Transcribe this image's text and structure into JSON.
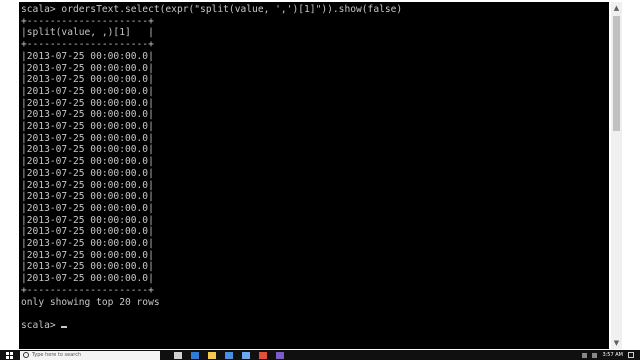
{
  "console": {
    "lines": [
      "scala> ordersText.select(expr(\"split(value, ',')[1]\")).show(false)",
      "+---------------------+",
      "|split(value, ,)[1]   |",
      "+---------------------+",
      "|2013-07-25 00:00:00.0|",
      "|2013-07-25 00:00:00.0|",
      "|2013-07-25 00:00:00.0|",
      "|2013-07-25 00:00:00.0|",
      "|2013-07-25 00:00:00.0|",
      "|2013-07-25 00:00:00.0|",
      "|2013-07-25 00:00:00.0|",
      "|2013-07-25 00:00:00.0|",
      "|2013-07-25 00:00:00.0|",
      "|2013-07-25 00:00:00.0|",
      "|2013-07-25 00:00:00.0|",
      "|2013-07-25 00:00:00.0|",
      "|2013-07-25 00:00:00.0|",
      "|2013-07-25 00:00:00.0|",
      "|2013-07-25 00:00:00.0|",
      "|2013-07-25 00:00:00.0|",
      "|2013-07-25 00:00:00.0|",
      "|2013-07-25 00:00:00.0|",
      "|2013-07-25 00:00:00.0|",
      "|2013-07-25 00:00:00.0|",
      "+---------------------+",
      "only showing top 20 rows",
      "",
      "scala> "
    ],
    "foreground": "#c7c7c7",
    "background": "#000000"
  },
  "scrollbar": {
    "up_icon": "scroll-up-arrow",
    "down_icon": "scroll-down-arrow",
    "up_glyph": "▲",
    "down_glyph": "▼"
  },
  "taskbar": {
    "start_icon": "windows-logo-icon",
    "search_placeholder": "Type here to search",
    "pinned": [
      {
        "name": "task-view-icon",
        "color": "#d0d0d0"
      },
      {
        "name": "edge-icon",
        "color": "#2f7bd8"
      },
      {
        "name": "file-explorer-icon",
        "color": "#f2c94c"
      },
      {
        "name": "store-icon",
        "color": "#4a90e2"
      },
      {
        "name": "mail-icon",
        "color": "#6aa8f0"
      },
      {
        "name": "chrome-icon",
        "color": "#e0503c"
      },
      {
        "name": "app-icon",
        "color": "#7a5cc9"
      }
    ],
    "clock_time": "3:57 AM"
  }
}
